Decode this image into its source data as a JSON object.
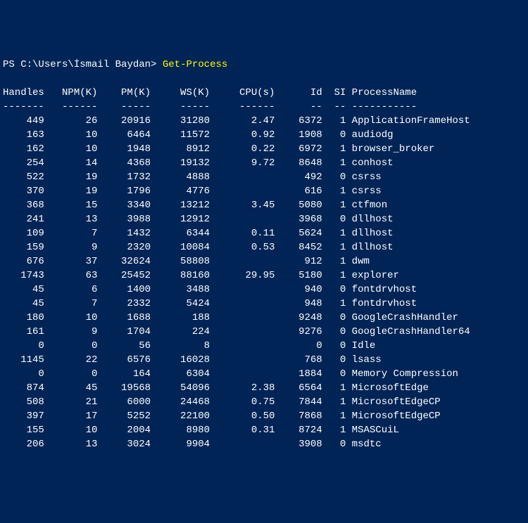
{
  "prompt_prefix": "PS ",
  "prompt_path": "C:\\Users\\İsmail Baydan>",
  "command": "Get-Process",
  "columns": [
    "Handles",
    "NPM(K)",
    "PM(K)",
    "WS(K)",
    "CPU(s)",
    "Id",
    "SI",
    "ProcessName"
  ],
  "rows": [
    {
      "handles": "449",
      "npm": "26",
      "pm": "20916",
      "ws": "31280",
      "cpu": "2.47",
      "id": "6372",
      "si": "1",
      "name": "ApplicationFrameHost"
    },
    {
      "handles": "163",
      "npm": "10",
      "pm": "6464",
      "ws": "11572",
      "cpu": "0.92",
      "id": "1908",
      "si": "0",
      "name": "audiodg"
    },
    {
      "handles": "162",
      "npm": "10",
      "pm": "1948",
      "ws": "8912",
      "cpu": "0.22",
      "id": "6972",
      "si": "1",
      "name": "browser_broker"
    },
    {
      "handles": "254",
      "npm": "14",
      "pm": "4368",
      "ws": "19132",
      "cpu": "9.72",
      "id": "8648",
      "si": "1",
      "name": "conhost"
    },
    {
      "handles": "522",
      "npm": "19",
      "pm": "1732",
      "ws": "4888",
      "cpu": "",
      "id": "492",
      "si": "0",
      "name": "csrss"
    },
    {
      "handles": "370",
      "npm": "19",
      "pm": "1796",
      "ws": "4776",
      "cpu": "",
      "id": "616",
      "si": "1",
      "name": "csrss"
    },
    {
      "handles": "368",
      "npm": "15",
      "pm": "3340",
      "ws": "13212",
      "cpu": "3.45",
      "id": "5080",
      "si": "1",
      "name": "ctfmon"
    },
    {
      "handles": "241",
      "npm": "13",
      "pm": "3988",
      "ws": "12912",
      "cpu": "",
      "id": "3968",
      "si": "0",
      "name": "dllhost"
    },
    {
      "handles": "109",
      "npm": "7",
      "pm": "1432",
      "ws": "6344",
      "cpu": "0.11",
      "id": "5624",
      "si": "1",
      "name": "dllhost"
    },
    {
      "handles": "159",
      "npm": "9",
      "pm": "2320",
      "ws": "10084",
      "cpu": "0.53",
      "id": "8452",
      "si": "1",
      "name": "dllhost"
    },
    {
      "handles": "676",
      "npm": "37",
      "pm": "32624",
      "ws": "58808",
      "cpu": "",
      "id": "912",
      "si": "1",
      "name": "dwm"
    },
    {
      "handles": "1743",
      "npm": "63",
      "pm": "25452",
      "ws": "88160",
      "cpu": "29.95",
      "id": "5180",
      "si": "1",
      "name": "explorer"
    },
    {
      "handles": "45",
      "npm": "6",
      "pm": "1400",
      "ws": "3488",
      "cpu": "",
      "id": "940",
      "si": "0",
      "name": "fontdrvhost"
    },
    {
      "handles": "45",
      "npm": "7",
      "pm": "2332",
      "ws": "5424",
      "cpu": "",
      "id": "948",
      "si": "1",
      "name": "fontdrvhost"
    },
    {
      "handles": "180",
      "npm": "10",
      "pm": "1688",
      "ws": "188",
      "cpu": "",
      "id": "9248",
      "si": "0",
      "name": "GoogleCrashHandler"
    },
    {
      "handles": "161",
      "npm": "9",
      "pm": "1704",
      "ws": "224",
      "cpu": "",
      "id": "9276",
      "si": "0",
      "name": "GoogleCrashHandler64"
    },
    {
      "handles": "0",
      "npm": "0",
      "pm": "56",
      "ws": "8",
      "cpu": "",
      "id": "0",
      "si": "0",
      "name": "Idle"
    },
    {
      "handles": "1145",
      "npm": "22",
      "pm": "6576",
      "ws": "16028",
      "cpu": "",
      "id": "768",
      "si": "0",
      "name": "lsass"
    },
    {
      "handles": "0",
      "npm": "0",
      "pm": "164",
      "ws": "6304",
      "cpu": "",
      "id": "1884",
      "si": "0",
      "name": "Memory Compression"
    },
    {
      "handles": "874",
      "npm": "45",
      "pm": "19568",
      "ws": "54096",
      "cpu": "2.38",
      "id": "6564",
      "si": "1",
      "name": "MicrosoftEdge"
    },
    {
      "handles": "508",
      "npm": "21",
      "pm": "6000",
      "ws": "24468",
      "cpu": "0.75",
      "id": "7844",
      "si": "1",
      "name": "MicrosoftEdgeCP"
    },
    {
      "handles": "397",
      "npm": "17",
      "pm": "5252",
      "ws": "22100",
      "cpu": "0.50",
      "id": "7868",
      "si": "1",
      "name": "MicrosoftEdgeCP"
    },
    {
      "handles": "155",
      "npm": "10",
      "pm": "2004",
      "ws": "8980",
      "cpu": "0.31",
      "id": "8724",
      "si": "1",
      "name": "MSASCuiL"
    },
    {
      "handles": "206",
      "npm": "13",
      "pm": "3024",
      "ws": "9904",
      "cpu": "",
      "id": "3908",
      "si": "0",
      "name": "msdtc"
    }
  ]
}
